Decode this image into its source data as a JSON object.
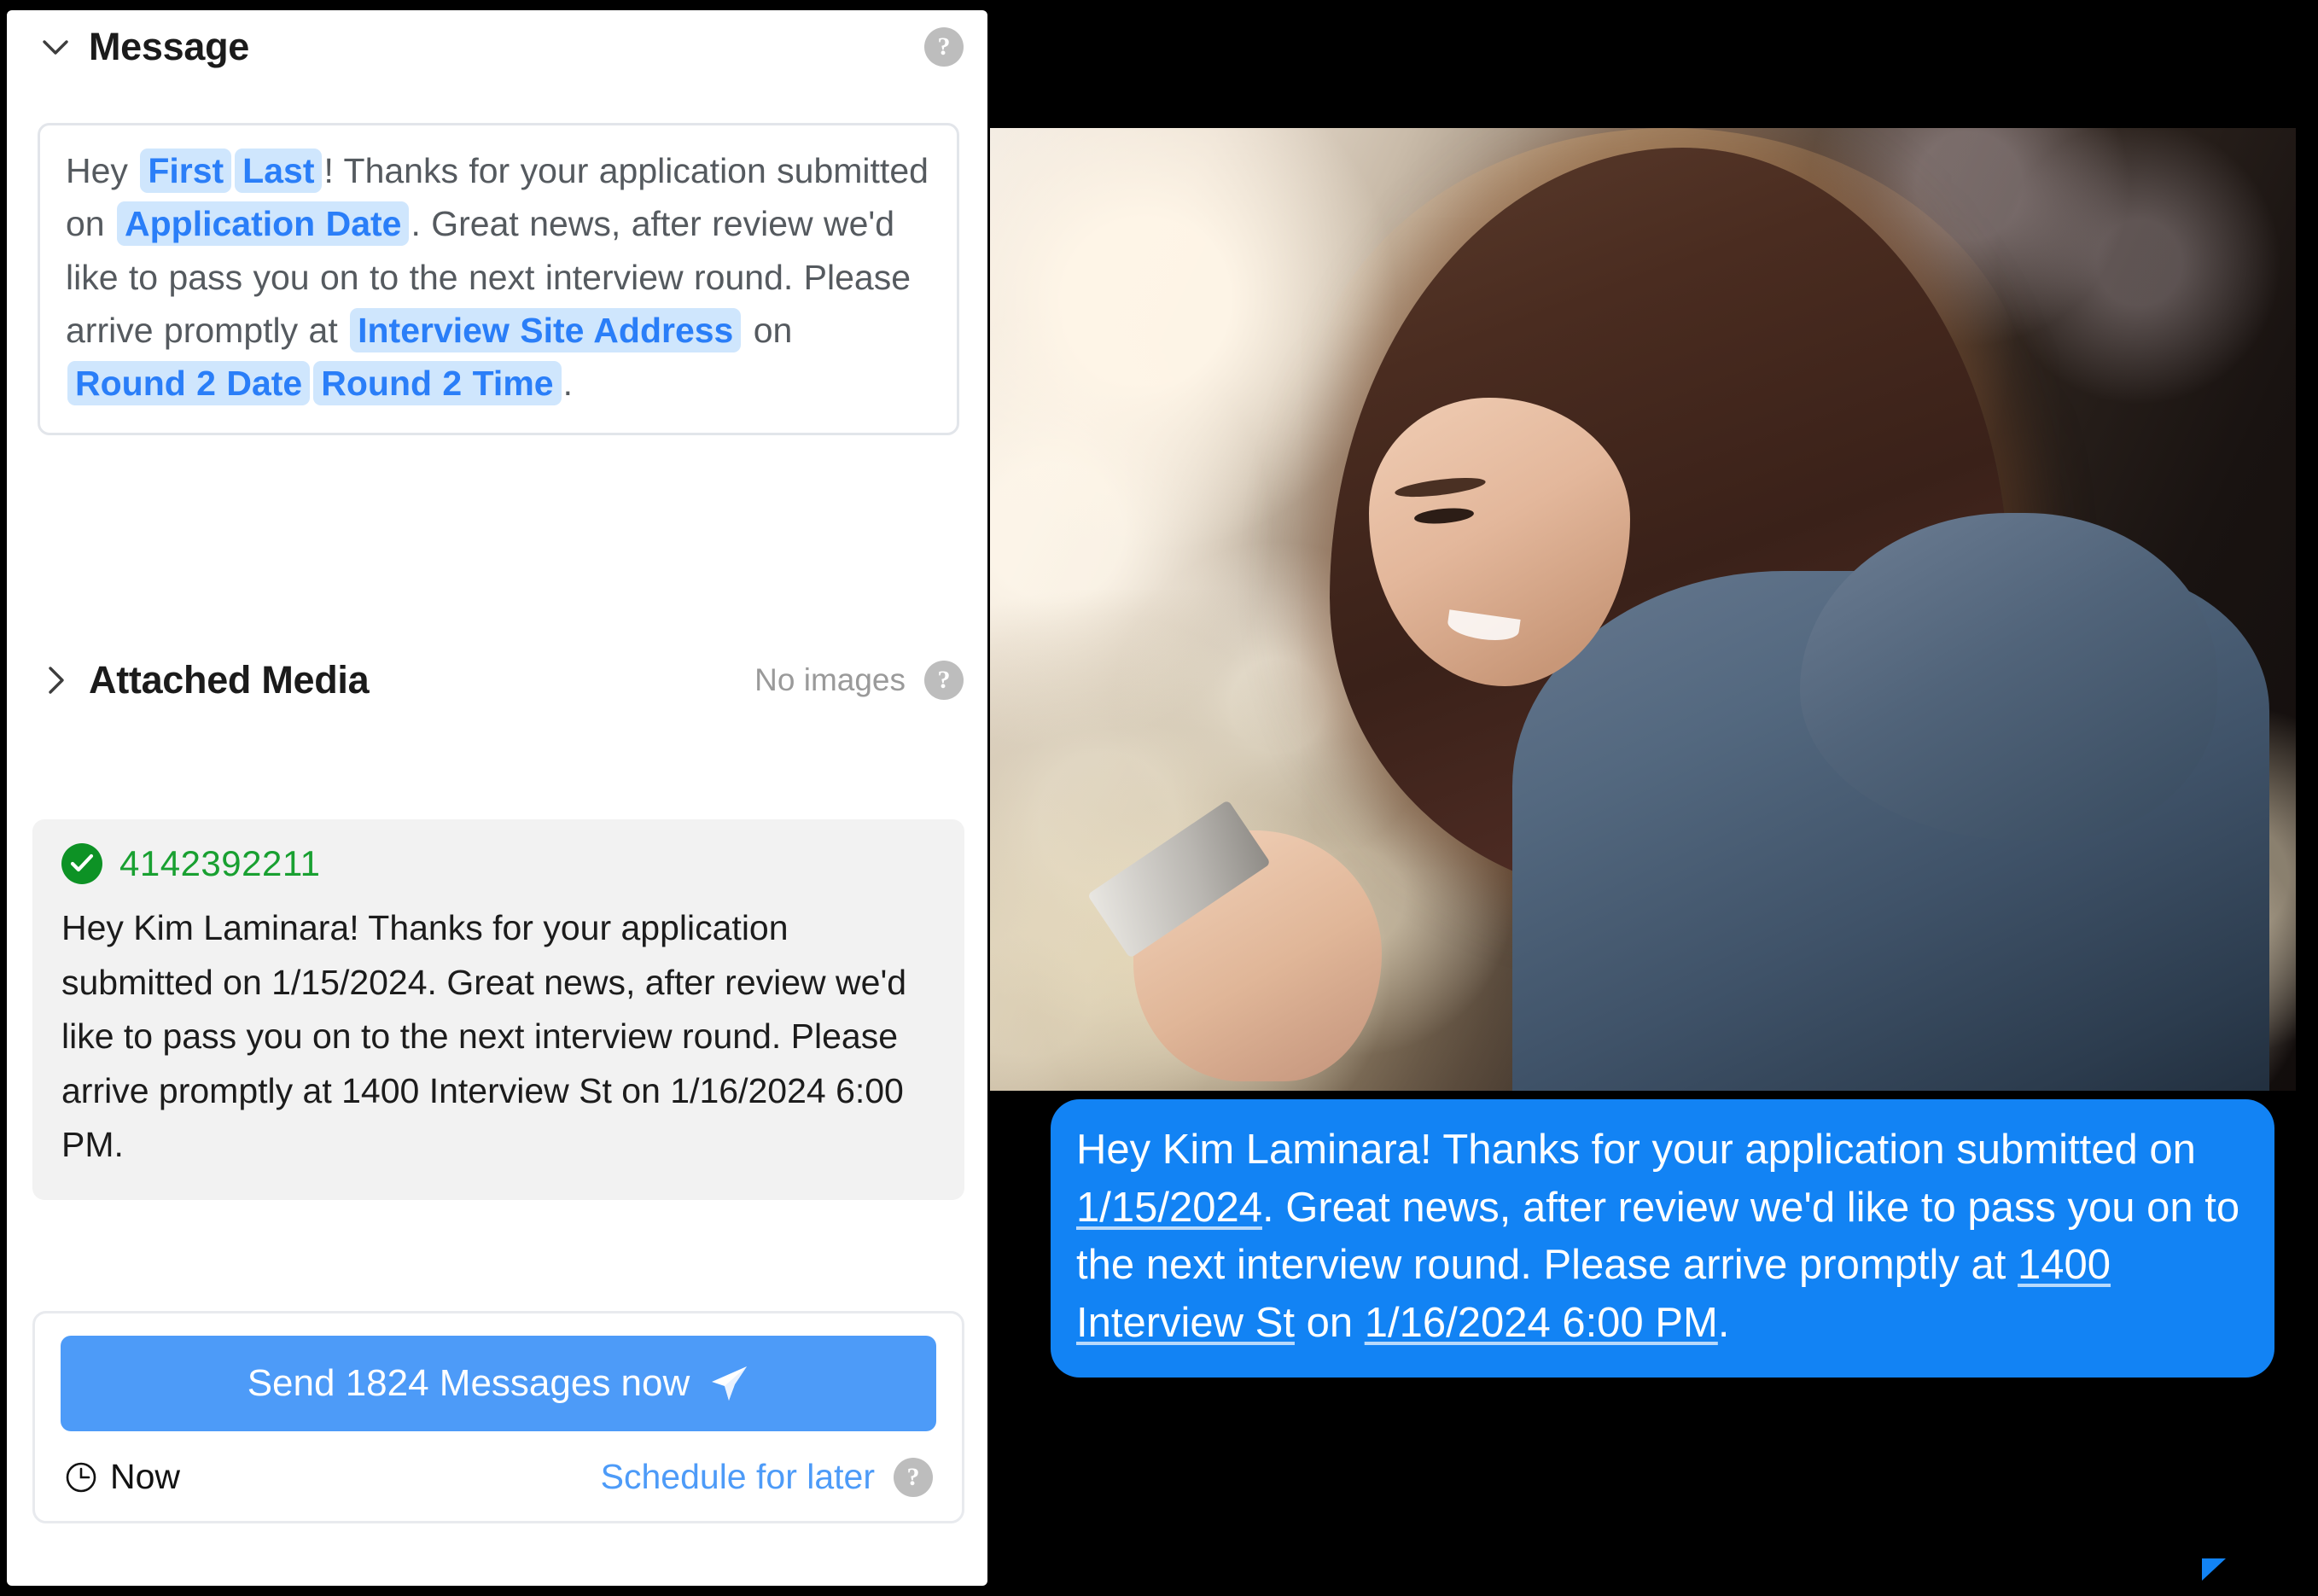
{
  "left_panel": {
    "message_section": {
      "title": "Message",
      "chevron_icon": "chevron-down-icon",
      "help_icon": "help-icon",
      "template_parts": [
        {
          "type": "text",
          "value": "Hey "
        },
        {
          "type": "chip",
          "value": "First"
        },
        {
          "type": "chip",
          "value": "Last"
        },
        {
          "type": "text",
          "value": "!  Thanks for your application submitted on "
        },
        {
          "type": "chip",
          "value": "Application Date"
        },
        {
          "type": "text",
          "value": ". Great news, after review we'd like to pass you on to the next interview round.  Please arrive promptly at "
        },
        {
          "type": "chip",
          "value": "Interview Site Address"
        },
        {
          "type": "text",
          "value": " on "
        },
        {
          "type": "chip",
          "value": "Round 2 Date"
        },
        {
          "type": "chip",
          "value": "Round 2 Time"
        },
        {
          "type": "text",
          "value": "."
        }
      ]
    },
    "attached_media_section": {
      "title": "Attached Media",
      "chevron_icon": "chevron-right-icon",
      "status": "No images",
      "help_icon": "help-icon"
    },
    "preview_card": {
      "status_icon": "check-circle-icon",
      "phone_number": "4142392211",
      "body": "Hey Kim Laminara!  Thanks for your application submitted on 1/15/2024. Great news, after review we'd like to pass you on to the next interview round.  Please arrive promptly at 1400 Interview St on 1/16/2024 6:00 PM."
    },
    "send_card": {
      "send_label": "Send 1824 Messages now",
      "send_icon": "paper-plane-icon",
      "message_count": "1824",
      "clock_icon": "clock-icon",
      "timing_label": "Now",
      "schedule_link": "Schedule for later",
      "help_icon": "help-icon"
    }
  },
  "right_panel": {
    "photo_alt": "young-woman-looking-at-phone-photo",
    "bubble_parts": [
      {
        "type": "text",
        "value": "Hey Kim Laminara!  Thanks for your application submitted on "
      },
      {
        "type": "link",
        "value": "1/15/2024"
      },
      {
        "type": "text",
        "value": ". Great news, after review we'd like to pass you on to the next interview round.  Please arrive promptly at "
      },
      {
        "type": "link",
        "value": "1400 Interview St"
      },
      {
        "type": "text",
        "value": " on "
      },
      {
        "type": "link",
        "value": "1/16/2024 6:00 PM"
      },
      {
        "type": "text",
        "value": "."
      }
    ]
  },
  "colors": {
    "accent_blue": "#4d9bf8",
    "bubble_blue": "#1283f4",
    "chip_bg": "#cfe6fd",
    "chip_text": "#2a7ef8",
    "success_green": "#0d9225",
    "number_green": "#19a031",
    "panel_bg": "#ffffff",
    "preview_bg": "#f2f2f2",
    "background": "#000000"
  }
}
